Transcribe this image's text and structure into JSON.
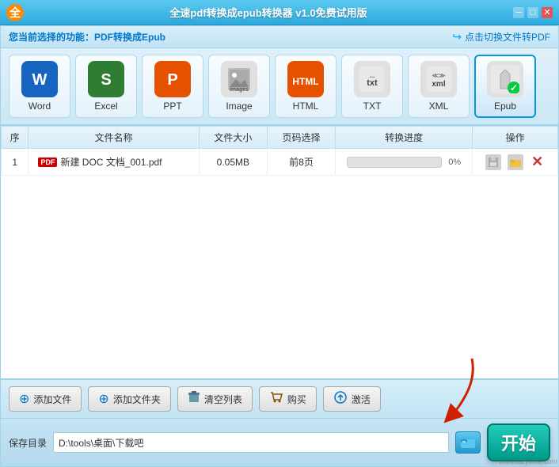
{
  "titleBar": {
    "logo": "全",
    "title": "全速pdf转换成epub转换器 v1.0免费试用版",
    "controls": [
      "─",
      "□",
      "✕"
    ]
  },
  "subToolbar": {
    "label": "您当前选择的功能：",
    "currentFunc": "PDF转换成Epub",
    "switchBtn": "点击切换文件转PDF"
  },
  "formats": [
    {
      "id": "word",
      "label": "Word",
      "icon": "W",
      "type": "word"
    },
    {
      "id": "excel",
      "label": "Excel",
      "icon": "S",
      "type": "excel"
    },
    {
      "id": "ppt",
      "label": "PPT",
      "icon": "P",
      "type": "ppt"
    },
    {
      "id": "image",
      "label": "Image",
      "icon": "🖼",
      "type": "image"
    },
    {
      "id": "html",
      "label": "HTML",
      "icon": "HTML",
      "type": "html"
    },
    {
      "id": "txt",
      "label": "TXT",
      "icon": "txt",
      "type": "txt"
    },
    {
      "id": "xml",
      "label": "XML",
      "icon": "xml",
      "type": "xml"
    },
    {
      "id": "epub",
      "label": "Epub",
      "icon": "◇",
      "type": "epub",
      "active": true
    }
  ],
  "table": {
    "headers": [
      "序",
      "文件名称",
      "文件大小",
      "页码选择",
      "转换进度",
      "操作"
    ],
    "rows": [
      {
        "seq": "1",
        "filename": "新建 DOC 文档_001.pdf",
        "size": "0.05MB",
        "pages": "前8页",
        "progress": 0,
        "progressLabel": "0%"
      }
    ]
  },
  "bottomButtons": [
    {
      "id": "add-file",
      "icon": "➕",
      "label": "添加文件"
    },
    {
      "id": "add-folder",
      "icon": "➕",
      "label": "添加文件夹"
    },
    {
      "id": "clear-list",
      "icon": "🗑",
      "label": "清空列表"
    },
    {
      "id": "buy",
      "icon": "🛍",
      "label": "购买"
    },
    {
      "id": "activate",
      "icon": "🔄",
      "label": "激活"
    }
  ],
  "savePath": {
    "label": "保存目录",
    "path": "D:\\tools\\桌面\\下载吧"
  },
  "startButton": {
    "label": "开始"
  },
  "watermark": "www.lazytime.com"
}
